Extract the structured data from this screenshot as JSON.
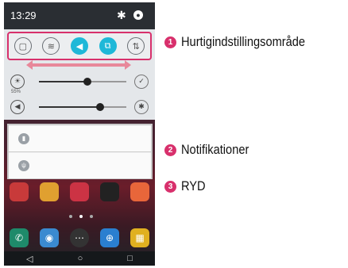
{
  "status_bar": {
    "time": "13:29",
    "settings_icon": "gear-icon",
    "user_icon": "user-icon"
  },
  "quick_settings": {
    "tiles": [
      {
        "icon": "square-icon",
        "glyph": "▢",
        "on": false
      },
      {
        "icon": "wifi-icon",
        "glyph": "≋",
        "on": false
      },
      {
        "icon": "sound-icon",
        "glyph": "◀",
        "on": true
      },
      {
        "icon": "screen-icon",
        "glyph": "⧉",
        "on": true
      },
      {
        "icon": "data-icon",
        "glyph": "⇅",
        "on": false
      }
    ]
  },
  "brightness": {
    "label": "55%",
    "level": 0.55,
    "icon": "brightness-icon",
    "auto_icon": "check-icon"
  },
  "volume": {
    "level": 0.7,
    "icon": "volume-icon",
    "settings_icon": "gear-icon"
  },
  "notifications": [
    {
      "icon": "battery-icon"
    },
    {
      "icon": "usb-icon"
    }
  ],
  "callouts": [
    {
      "number": "1",
      "label": "Hurtigindstillingsområde"
    },
    {
      "number": "2",
      "label": "Notifikationer"
    },
    {
      "number": "3",
      "label": "RYD"
    }
  ],
  "colors": {
    "accent": "#d8306c",
    "tile_on": "#1fb8d8"
  }
}
